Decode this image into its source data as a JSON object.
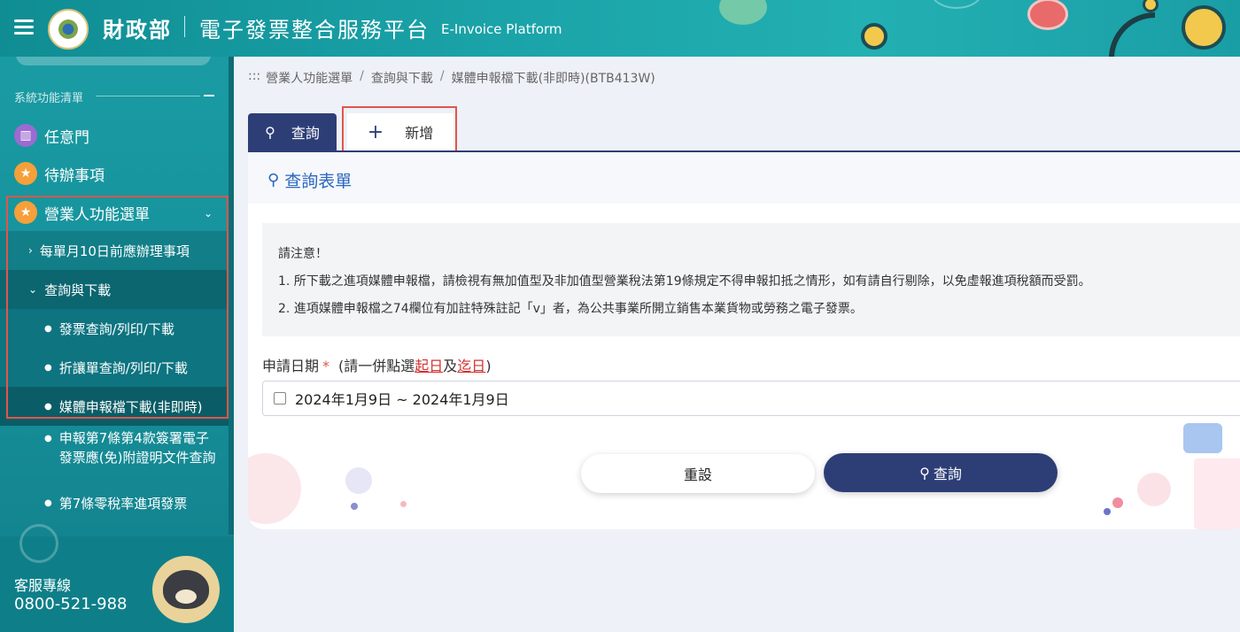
{
  "header": {
    "brand": "財政部",
    "platform": "電子發票整合服務平台",
    "platform_en": "E-Invoice Platform"
  },
  "sidebar": {
    "section_label": "系統功能清單",
    "top_items": [
      {
        "label": "任意門",
        "icon": "map-icon"
      },
      {
        "label": "待辦事項",
        "icon": "star-icon"
      },
      {
        "label": "營業人功能選單",
        "icon": "star-icon"
      }
    ],
    "sub_items": [
      {
        "label": "每單月10日前應辦理事項"
      },
      {
        "label": "查詢與下載"
      }
    ],
    "leaf_items": [
      {
        "label": "發票查詢/列印/下載"
      },
      {
        "label": "折讓單查詢/列印/下載"
      },
      {
        "label": "媒體申報檔下載(非即時)"
      },
      {
        "label": "申報第7條第4款簽署電子發票應(免)附證明文件查詢"
      },
      {
        "label": "第7條零稅率進項發票"
      }
    ],
    "hotline_label": "客服專線",
    "hotline_number": "0800-521-988"
  },
  "breadcrumb": {
    "prefix": ":::",
    "items": [
      "營業人功能選單",
      "查詢與下載",
      "媒體申報檔下載(非即時)(BTB413W)"
    ],
    "separator": "/"
  },
  "tabs": {
    "query_label": "查詢",
    "add_label": "新增"
  },
  "form": {
    "title": "查詢表單",
    "notice_title": "請注意！",
    "notice_lines": [
      "1. 所下載之進項媒體申報檔，請檢視有無加值型及非加值型營業稅法第19條規定不得申報扣抵之情形，如有請自行剔除，以免虛報進項稅額而受罰。",
      "2. 進項媒體申報檔之74欄位有加註特殊註記「v」者，為公共事業所開立銷售本業貨物或勞務之電子發票。"
    ],
    "date_label": "申請日期",
    "required_mark": "*",
    "hint_prefix": "(請一併點選",
    "hint_start": "起日",
    "hint_mid": "及",
    "hint_end": "迄日",
    "hint_suffix": ")",
    "date_value": "2024年1月9日 ~ 2024年1月9日",
    "reset_label": "重設",
    "search_label": "查詢"
  },
  "colors": {
    "header": "#1aa3a8",
    "sidebar": "#15909a",
    "primary": "#2d3e76",
    "link": "#2a67c0",
    "highlight": "#e0564a"
  }
}
